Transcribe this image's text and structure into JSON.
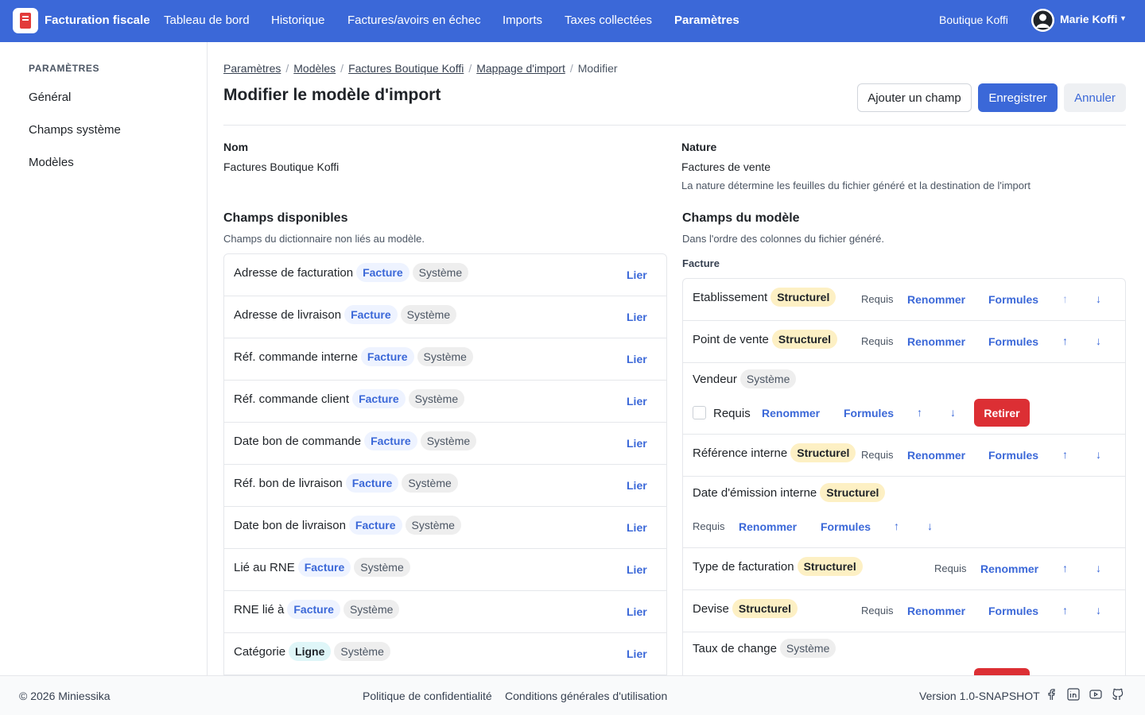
{
  "app": {
    "title": "Facturation fiscale",
    "company": "Boutique Koffi",
    "user": "Marie Koffi"
  },
  "nav": [
    "Tableau de bord",
    "Historique",
    "Factures/avoirs en échec",
    "Imports",
    "Taxes collectées",
    "Paramètres"
  ],
  "sidebar": {
    "title": "PARAMÈTRES",
    "items": [
      "Général",
      "Champs système",
      "Modèles"
    ]
  },
  "breadcrumb": [
    "Paramètres",
    "Modèles",
    "Factures Boutique Koffi",
    "Mappage d'import",
    "Modifier"
  ],
  "page": {
    "title": "Modifier le modèle d'import",
    "add_field": "Ajouter un champ",
    "save": "Enregistrer",
    "cancel": "Annuler"
  },
  "form": {
    "name_label": "Nom",
    "name_value": "Factures Boutique Koffi",
    "nature_label": "Nature",
    "nature_value": "Factures de vente",
    "nature_hint": "La nature détermine les feuilles du fichier généré et la destination de l'import"
  },
  "available": {
    "title": "Champs disponibles",
    "subtitle": "Champs du dictionnaire non liés au modèle.",
    "link_label": "Lier",
    "rows": [
      {
        "name": "Adresse de facturation",
        "tag": "Facture",
        "kind": "Système"
      },
      {
        "name": "Adresse de livraison",
        "tag": "Facture",
        "kind": "Système"
      },
      {
        "name": "Réf. commande interne",
        "tag": "Facture",
        "kind": "Système"
      },
      {
        "name": "Réf. commande client",
        "tag": "Facture",
        "kind": "Système"
      },
      {
        "name": "Date bon de commande",
        "tag": "Facture",
        "kind": "Système"
      },
      {
        "name": "Réf. bon de livraison",
        "tag": "Facture",
        "kind": "Système"
      },
      {
        "name": "Date bon de livraison",
        "tag": "Facture",
        "kind": "Système"
      },
      {
        "name": "Lié au RNE",
        "tag": "Facture",
        "kind": "Système"
      },
      {
        "name": "RNE lié à",
        "tag": "Facture",
        "kind": "Système"
      },
      {
        "name": "Catégorie",
        "tag": "Ligne",
        "kind": "Système"
      }
    ]
  },
  "model": {
    "title": "Champs du modèle",
    "subtitle": "Dans l'ordre des colonnes du fichier généré.",
    "group": "Facture",
    "labels": {
      "required": "Requis",
      "rename": "Renommer",
      "formulas": "Formules",
      "remove": "Retirer",
      "up": "↑",
      "down": "↓"
    },
    "rows": [
      {
        "name": "Etablissement",
        "kind": "Structurel"
      },
      {
        "name": "Point de vente",
        "kind": "Structurel"
      },
      {
        "name": "Vendeur",
        "kind": "Système"
      },
      {
        "name": "Référence interne",
        "kind": "Structurel"
      },
      {
        "name": "Date d'émission interne",
        "kind": "Structurel"
      },
      {
        "name": "Type de facturation",
        "kind": "Structurel"
      },
      {
        "name": "Devise",
        "kind": "Structurel"
      },
      {
        "name": "Taux de change",
        "kind": "Système"
      }
    ]
  },
  "footer": {
    "copyright": "© 2026 Miniessika",
    "privacy": "Politique de confidentialité",
    "terms": "Conditions générales d'utilisation",
    "version": "Version 1.0-SNAPSHOT"
  },
  "colors": {
    "primary": "#3b68d8",
    "danger": "#dc2f34",
    "structurel": "#fdf0c4"
  }
}
